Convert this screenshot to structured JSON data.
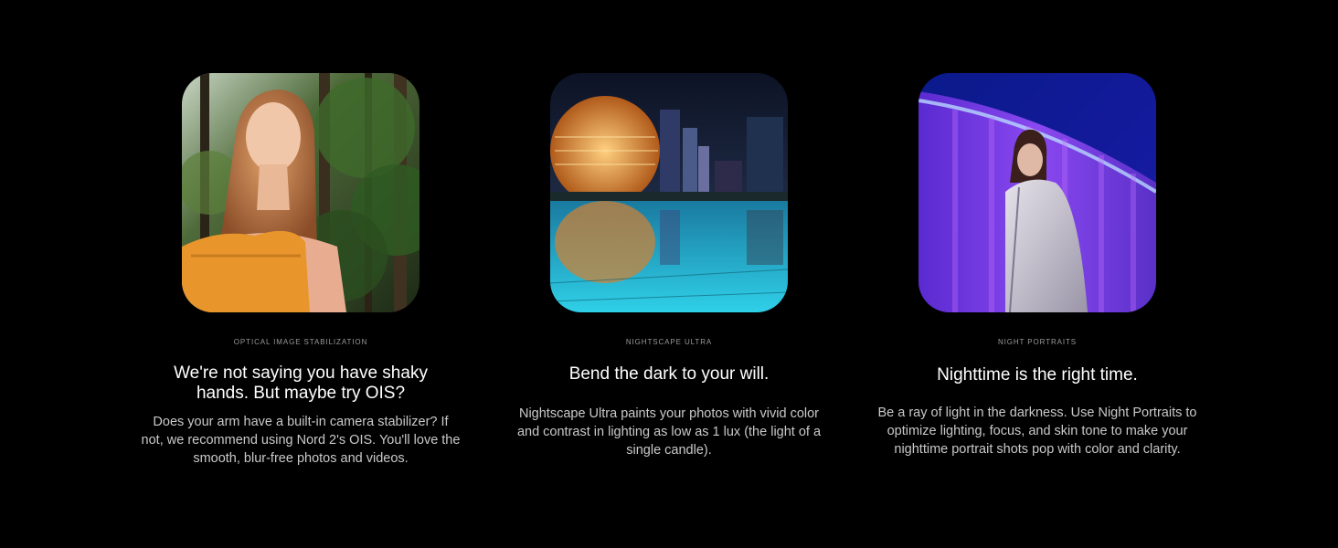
{
  "features": [
    {
      "eyebrow": "OPTICAL IMAGE STABILIZATION",
      "headline": "We're not saying you have shaky hands. But maybe try OIS?",
      "body": "Does your arm have a built-in camera stabilizer? If not, we recommend using Nord 2's OIS. You'll love the smooth, blur-free photos and videos.",
      "image_subject": "woman-in-forest-photo"
    },
    {
      "eyebrow": "NIGHTSCAPE ULTRA",
      "headline": "Bend the dark to your will.",
      "body": "Nightscape Ultra paints your photos with vivid color and contrast in lighting as low as 1 lux (the light of a single candle).",
      "image_subject": "city-night-reflection-photo"
    },
    {
      "eyebrow": "NIGHT PORTRAITS",
      "headline": "Nighttime is the right time.",
      "body": "Be a ray of light in the darkness. Use Night Portraits to optimize lighting, focus, and skin tone to make your nighttime portrait shots pop with color and clarity.",
      "image_subject": "night-portrait-photo"
    }
  ],
  "colors": {
    "background": "#000000",
    "headline": "#ffffff",
    "body": "#c9c9c9",
    "eyebrow": "#9a9a9a"
  }
}
